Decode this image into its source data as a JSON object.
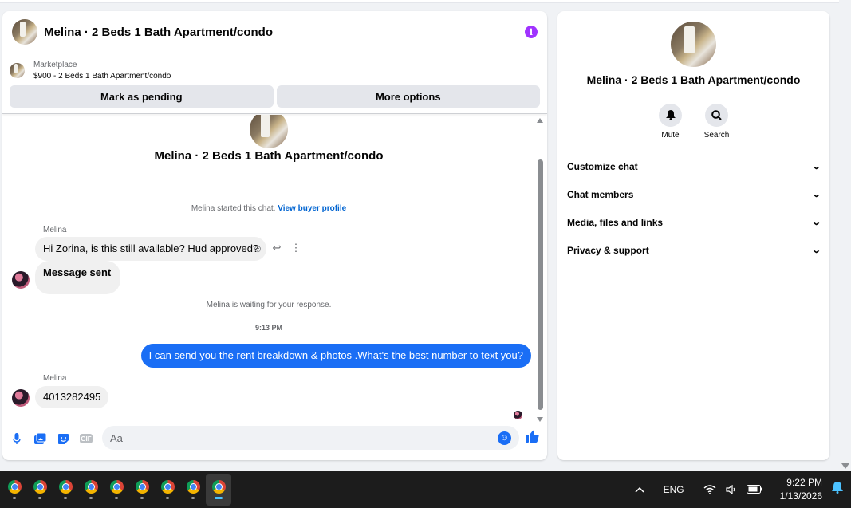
{
  "chat": {
    "header_title": "Melina · 2 Beds 1 Bath Apartment/condo",
    "info_icon": "i",
    "marketplace": {
      "label": "Marketplace",
      "listing": "$900 - 2 Beds 1 Bath Apartment/condo",
      "mark_pending": "Mark as pending",
      "more_options": "More options"
    },
    "intro_name": "Melina · 2 Beds 1 Bath Apartment/condo",
    "started_text": "Melina started this chat.",
    "view_profile": "View buyer profile",
    "messages": [
      {
        "sender": "Melina",
        "text": "Hi Zorina, is this still available? Hud approved?"
      },
      {
        "text": "Message sent"
      },
      {
        "system": "Melina is waiting for your response."
      },
      {
        "timestamp": "9:13 PM"
      },
      {
        "outgoing": true,
        "text": "I can send you the rent breakdown & photos .What's the best number to text you?"
      },
      {
        "sender": "Melina",
        "text": "4013282495"
      }
    ],
    "composer_placeholder": "Aa",
    "gif_label": "GIF"
  },
  "info_panel": {
    "name": "Melina · 2 Beds 1 Bath Apartment/condo",
    "actions": [
      {
        "label": "Mute",
        "icon": "bell-icon"
      },
      {
        "label": "Search",
        "icon": "search-icon"
      }
    ],
    "sections": [
      "Customize chat",
      "Chat members",
      "Media, files and links",
      "Privacy & support"
    ]
  },
  "taskbar": {
    "app_count": 9,
    "language": "ENG",
    "time": "9:22 PM",
    "date": "1/13/2026"
  },
  "colors": {
    "accent": "#1a6ef5",
    "info_icon": "#a033ff",
    "link": "#0064d1"
  }
}
